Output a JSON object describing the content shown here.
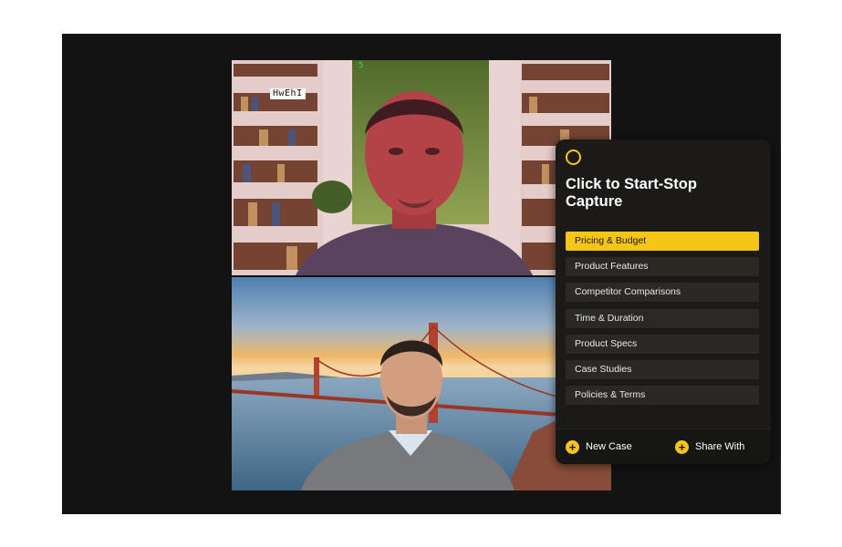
{
  "participants": [
    {
      "name_tag": "HwEhI",
      "corner_mark": "5"
    },
    {}
  ],
  "capture_panel": {
    "title": "Click to Start-Stop Capture",
    "topics": [
      {
        "label": "Pricing & Budget",
        "active": true
      },
      {
        "label": "Product Features",
        "active": false
      },
      {
        "label": "Competitor Comparisons",
        "active": false
      },
      {
        "label": "Time & Duration",
        "active": false
      },
      {
        "label": "Product Specs",
        "active": false
      },
      {
        "label": "Case Studies",
        "active": false
      },
      {
        "label": "Policies & Terms",
        "active": false
      }
    ],
    "footer": {
      "new_case_label": "New Case",
      "share_with_label": "Share With",
      "plus_icon": "+"
    }
  },
  "colors": {
    "accent": "#f5c518",
    "panel_bg": "#1b1a19",
    "stage_bg": "#131313"
  }
}
